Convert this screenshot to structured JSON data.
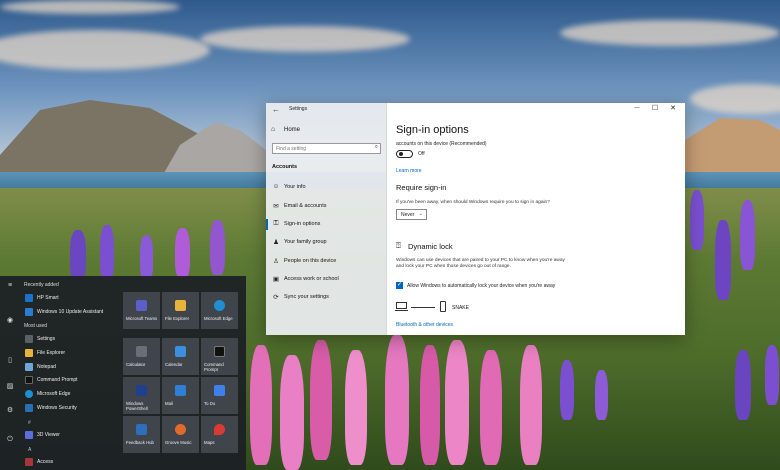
{
  "settings": {
    "app_title": "Settings",
    "back_glyph": "←",
    "home_label": "Home",
    "search_placeholder": "Find a setting",
    "section_heading": "Accounts",
    "nav_items": [
      {
        "label": "Your info",
        "icon": "person-icon",
        "glyph": "☺"
      },
      {
        "label": "Email & accounts",
        "icon": "mail-icon",
        "glyph": "✉"
      },
      {
        "label": "Sign-in options",
        "icon": "key-icon",
        "glyph": "⚿"
      },
      {
        "label": "Your family group",
        "icon": "family-icon",
        "glyph": "♟"
      },
      {
        "label": "People on this device",
        "icon": "people-icon",
        "glyph": "♙"
      },
      {
        "label": "Access work or school",
        "icon": "briefcase-icon",
        "glyph": "▣"
      },
      {
        "label": "Sync your settings",
        "icon": "sync-icon",
        "glyph": "⟳"
      }
    ],
    "controls": {
      "minimize": "—",
      "maximize": "☐",
      "close": "✕"
    }
  },
  "content": {
    "page_title": "Sign-in options",
    "cut_text": "accounts on this device (Recommended)",
    "toggle_state": "Off",
    "learn_more": "Learn more",
    "require_heading": "Require sign-in",
    "require_text": "If you've been away, when should Windows require you to sign in again?",
    "dropdown_value": "Never",
    "dynamic_heading": "Dynamic lock",
    "dynamic_text": "Windows can use devices that are paired to your PC to know when you're away and lock your PC when those devices go out of range.",
    "checkbox_label": "Allow Windows to automatically lock your device when you're away",
    "checkbox_checked": true,
    "device_name": "SNAKE",
    "bt_link": "Bluetooth & other devices"
  },
  "start_menu": {
    "recently_added": "Recently added",
    "recent_apps": [
      {
        "label": "HP Smart",
        "color": "#1a73c9"
      },
      {
        "label": "Windows 10 Update Assistant",
        "color": "#2a7bd4"
      }
    ],
    "most_used": "Most used",
    "most_used_apps": [
      {
        "label": "Settings",
        "color": "#5b5f66"
      },
      {
        "label": "File Explorer",
        "color": "#e8b33a"
      },
      {
        "label": "Notepad",
        "color": "#6fa6d6"
      },
      {
        "label": "Command Prompt",
        "color": "#111111"
      },
      {
        "label": "Microsoft Edge",
        "color": "#1f8fd1"
      },
      {
        "label": "Windows Security",
        "color": "#2a6db0"
      }
    ],
    "letter_hash": "#",
    "hash_apps": [
      {
        "label": "3D Viewer",
        "color": "#5a6ee0"
      }
    ],
    "letter_a": "A",
    "a_apps": [
      {
        "label": "Access",
        "color": "#a4373a"
      }
    ],
    "rail_icons": [
      {
        "name": "hamburger-icon",
        "glyph": "≡"
      },
      {
        "name": "account-icon",
        "glyph": "◉"
      },
      {
        "name": "document-icon",
        "glyph": "▯"
      },
      {
        "name": "pictures-icon",
        "glyph": "▨"
      },
      {
        "name": "settings-icon",
        "glyph": "⚙"
      },
      {
        "name": "power-icon",
        "glyph": "⏻"
      }
    ],
    "tiles": [
      {
        "label": "Microsoft Teams",
        "color": "#5b5fc7"
      },
      {
        "label": "File Explorer",
        "color": "#e8b33a"
      },
      {
        "label": "Microsoft Edge",
        "color": "#1f8fd1"
      },
      {
        "label": "Calculator",
        "color": "#6a6e76"
      },
      {
        "label": "Calendar",
        "color": "#3b8ee0"
      },
      {
        "label": "Command Prompt",
        "color": "#111111"
      },
      {
        "label": "Windows PowerShell",
        "color": "#1f3f8f"
      },
      {
        "label": "Mail",
        "color": "#2f7fd6"
      },
      {
        "label": "To Do",
        "color": "#3f7fe8"
      },
      {
        "label": "Feedback Hub",
        "color": "#2d6fbd"
      },
      {
        "label": "Groove Music",
        "color": "#e06a2a"
      },
      {
        "label": "Maps",
        "color": "#d93a34"
      }
    ]
  }
}
